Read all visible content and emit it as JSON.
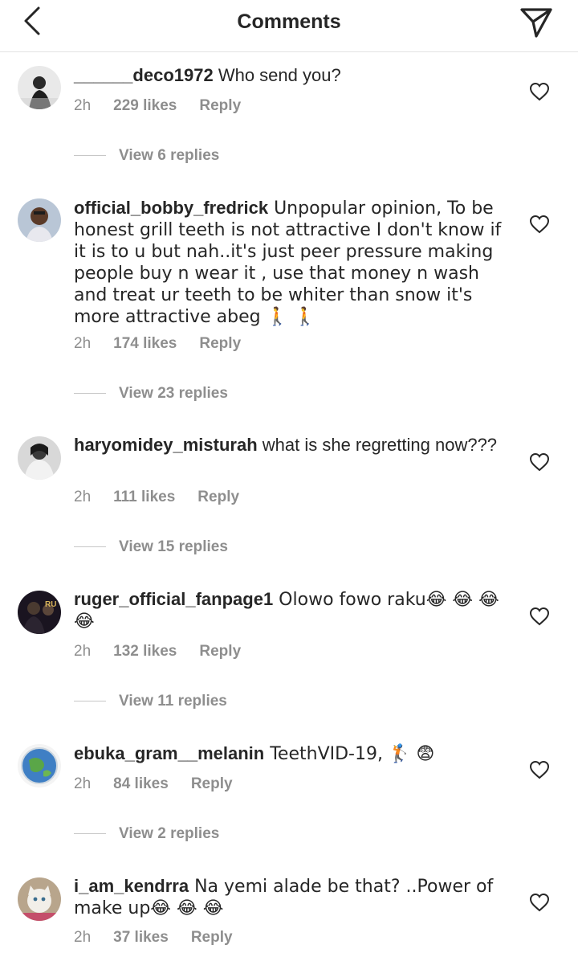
{
  "header": {
    "title": "Comments"
  },
  "comments": [
    {
      "username": "______deco1972",
      "text": " Who send you?",
      "time": "2h",
      "likes": "229 likes",
      "reply": "Reply",
      "view_replies": "View 6 replies"
    },
    {
      "username": "official_bobby_fredrick",
      "text": " Unpopular opinion, To be honest grill teeth is not attractive I don't know if it is to u but nah..it's just peer pressure making people buy n wear it , use that money n wash and treat ur teeth to be whiter than snow it's more attractive abeg 🚶 🚶",
      "time": "2h",
      "likes": "174 likes",
      "reply": "Reply",
      "view_replies": "View 23 replies"
    },
    {
      "username": "haryomidey_misturah",
      "text": " what is she regretting now???",
      "time": "2h",
      "likes": "111 likes",
      "reply": "Reply",
      "view_replies": "View 15 replies"
    },
    {
      "username": "ruger_official_fanpage1",
      "text": " Olowo fowo raku😂 😂 😂 😂",
      "time": "2h",
      "likes": "132 likes",
      "reply": "Reply",
      "view_replies": "View 11 replies"
    },
    {
      "username": "ebuka_gram__melanin",
      "text": " TeethVID-19, 🏌 😨",
      "time": "2h",
      "likes": "84 likes",
      "reply": "Reply",
      "view_replies": "View 2 replies"
    },
    {
      "username": "i_am_kendrra",
      "text": " Na yemi alade be that? ..Power of make up😂 😂 😂",
      "time": "2h",
      "likes": "37 likes",
      "reply": "Reply"
    }
  ]
}
